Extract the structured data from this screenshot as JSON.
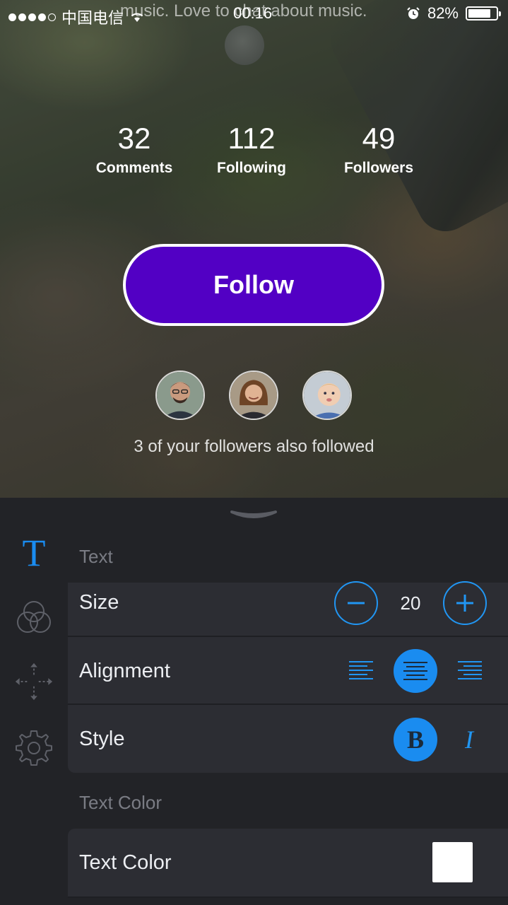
{
  "status_bar": {
    "carrier": "中国电信",
    "marquee": "music. Love to chat about music.",
    "time": "00:16",
    "battery_percent": "82%",
    "battery_level": 0.82
  },
  "profile": {
    "stats": [
      {
        "value": "32",
        "label": "Comments"
      },
      {
        "value": "112",
        "label": "Following"
      },
      {
        "value": "49",
        "label": "Followers"
      }
    ],
    "follow_label": "Follow",
    "followers_note": "3 of your followers also followed"
  },
  "panel": {
    "text_section": "Text",
    "size_label": "Size",
    "size_value": "20",
    "alignment_label": "Alignment",
    "style_label": "Style",
    "bold_glyph": "B",
    "italic_glyph": "I",
    "text_color_section": "Text Color",
    "text_color_label": "Text Color",
    "text_color_value": "#ffffff",
    "text_glyph": "T"
  },
  "colors": {
    "accent": "#1a8cf0",
    "follow_button": "#5200c4"
  }
}
